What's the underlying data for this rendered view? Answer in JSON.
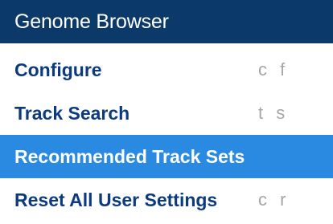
{
  "menu": {
    "title": "Genome Browser",
    "items": [
      {
        "label": "Configure",
        "shortcut": "c f",
        "active": false
      },
      {
        "label": "Track Search",
        "shortcut": "t s",
        "active": false
      },
      {
        "label": "Recommended Track Sets",
        "shortcut": "",
        "active": true
      },
      {
        "label": "Reset All User Settings",
        "shortcut": "c r",
        "active": false
      }
    ]
  },
  "colors": {
    "header_background": "#0b3a6a",
    "item_text": "#0b3a80",
    "active_background": "#2a8ae2",
    "shortcut_text": "#a6a6a6"
  }
}
